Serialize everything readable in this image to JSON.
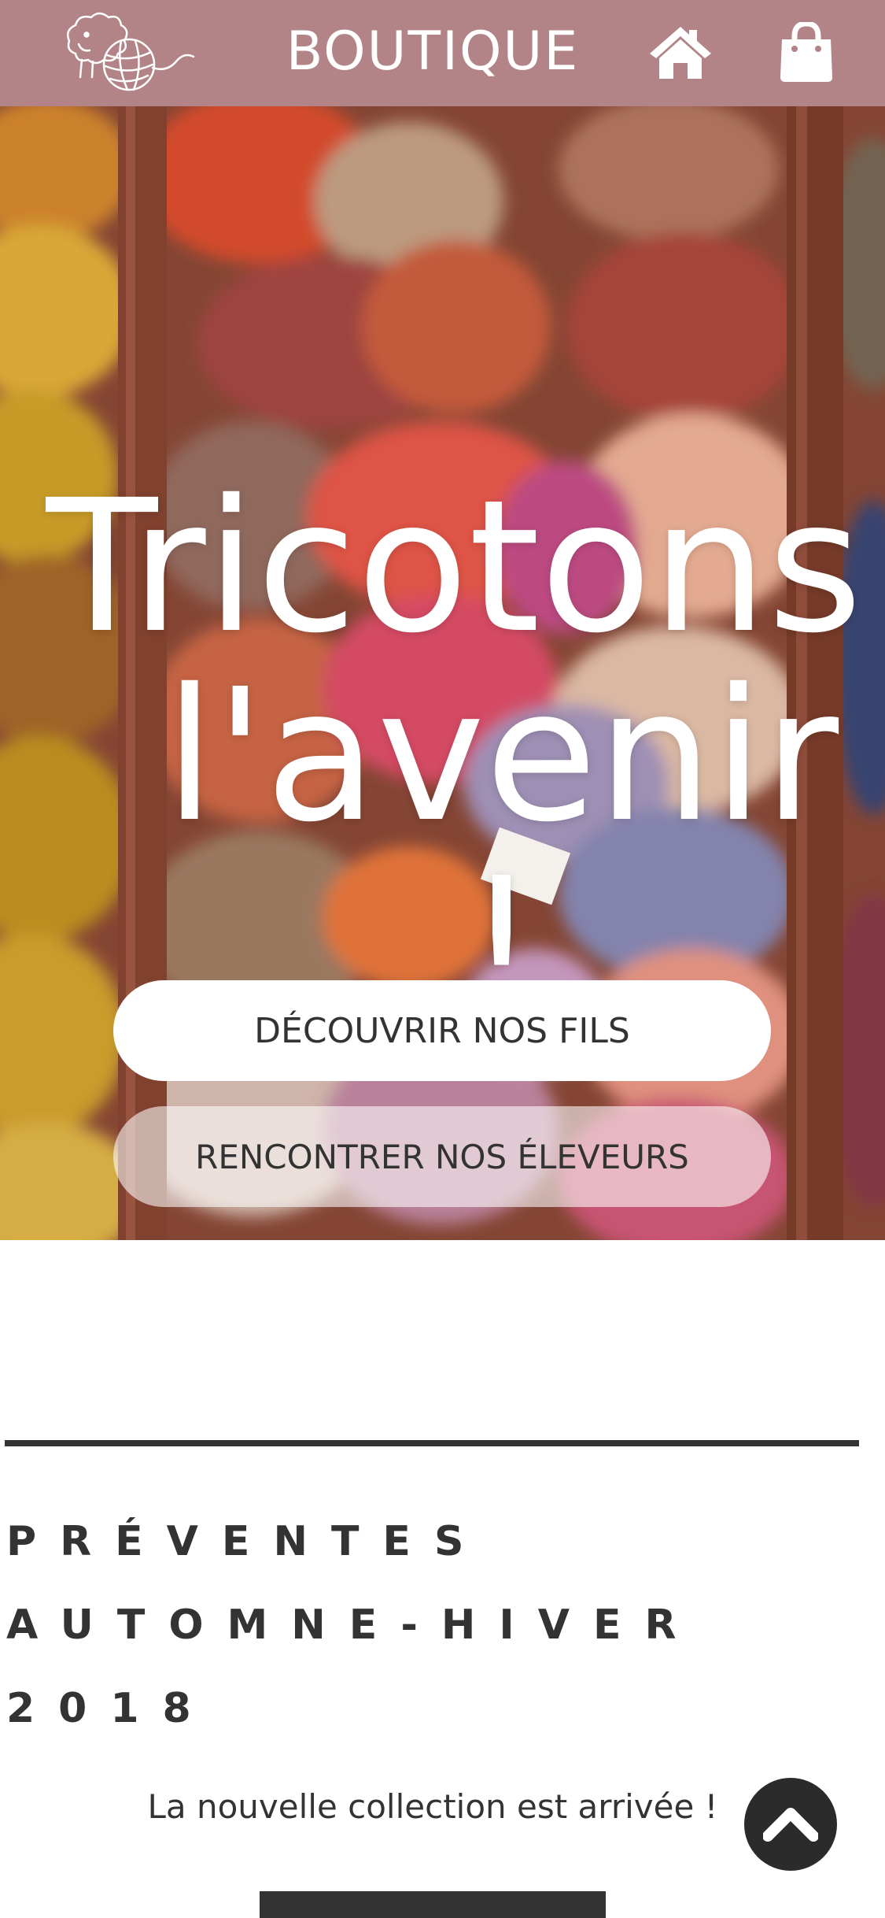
{
  "header": {
    "brand": "BOUTIQUE",
    "logo_icon": "sheep-yarn-logo-icon",
    "home_icon": "home-icon",
    "cart_icon": "shopping-bag-icon",
    "background": "#b28488"
  },
  "hero": {
    "title_line1": "Tricotons",
    "title_line2": "l'avenir !",
    "primary_button": "DÉCOUVRIR NOS FILS",
    "secondary_button": "RENCONTRER NOS ÉLEVEURS"
  },
  "section": {
    "title_line1": "PRÉVENTES",
    "title_line2": "AUTOMNE-HIVER",
    "title_line3": "2018",
    "subtitle": "La nouvelle collection est arrivée !"
  },
  "scroll_top": {
    "icon": "chevron-up-icon"
  }
}
